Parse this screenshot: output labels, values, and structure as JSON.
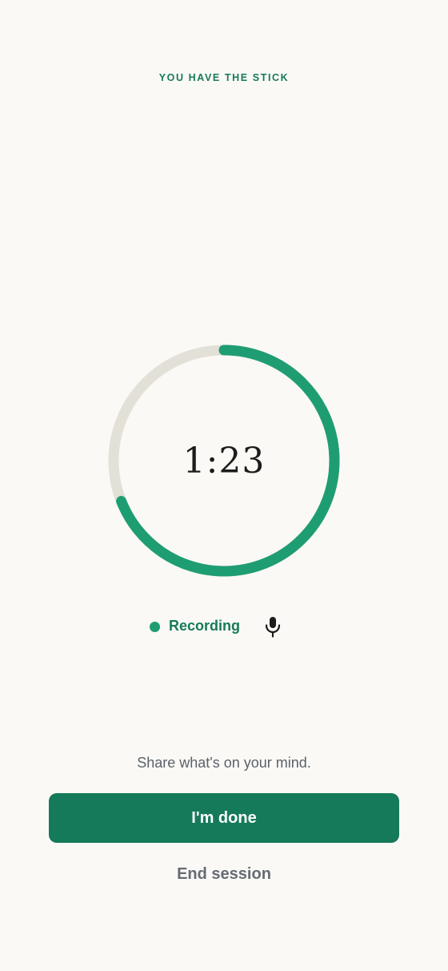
{
  "header": {
    "kicker": "YOU HAVE THE STICK"
  },
  "timer": {
    "display": "1:23",
    "progress": 0.69,
    "colors": {
      "progress": "#1f9d72",
      "track": "#e3e0d8"
    }
  },
  "status": {
    "label": "Recording",
    "dot_color": "#1f9d72",
    "mic_icon": "microphone-icon"
  },
  "prompt": "Share what's on your mind.",
  "actions": {
    "done_label": "I'm done",
    "end_label": "End session",
    "accent_color": "#157a5a"
  }
}
